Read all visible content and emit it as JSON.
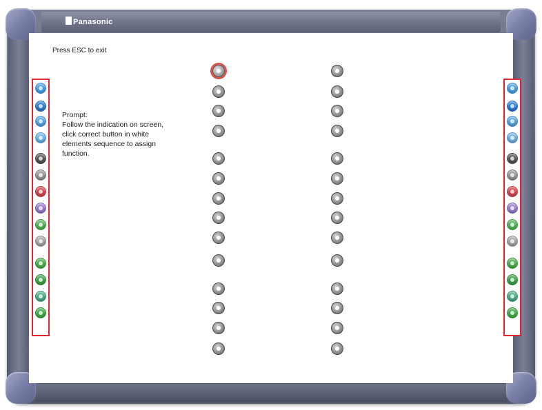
{
  "window": {
    "logo_text": "Panasonic"
  },
  "board": {
    "hint": "Press ESC to exit",
    "prompt": "Prompt:\nFollow the indication on screen, click correct button in white elements sequence to assign function."
  },
  "colors": {
    "frame": "#5f6479",
    "corner": "#7b80a8",
    "highlight": "#e0262e"
  },
  "pen_tray_icons": [
    {
      "name": "light-blue-pen-icon",
      "color": "#4aa3e8"
    },
    {
      "name": "blue-pen-icon",
      "color": "#2e7fd6"
    },
    {
      "name": "light-blue-pen-icon",
      "color": "#5aa8e6"
    },
    {
      "name": "sky-pen-icon",
      "color": "#6fb6ea"
    },
    {
      "name": "black-pen-icon",
      "color": "#555555"
    },
    {
      "name": "grey-pen-icon",
      "color": "#9a9a9a"
    },
    {
      "name": "red-pen-icon",
      "color": "#d9474f"
    },
    {
      "name": "purple-pen-icon",
      "color": "#9a7fd0"
    },
    {
      "name": "green-pen-icon",
      "color": "#57b55a"
    },
    {
      "name": "grey-pen-icon",
      "color": "#a8a8a8"
    },
    {
      "name": "green-pen-icon",
      "color": "#4fb04f"
    },
    {
      "name": "green-pen-icon",
      "color": "#3ea64a"
    },
    {
      "name": "teal-pen-icon",
      "color": "#4eb08a"
    },
    {
      "name": "green-pen-icon",
      "color": "#42ad48"
    }
  ],
  "targets": {
    "rows": 15,
    "selected_index": 0
  }
}
